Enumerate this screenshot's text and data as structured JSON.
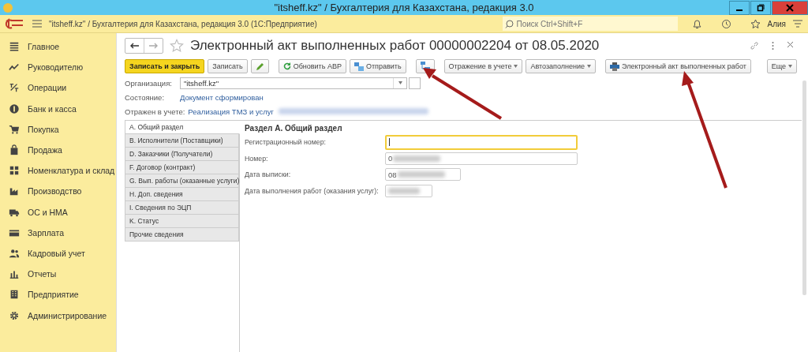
{
  "window": {
    "title": "\"itsheff.kz\" / Бухгалтерия для Казахстана, редакция 3.0"
  },
  "app_bar": {
    "title": "\"itsheff.kz\" / Бухгалтерия для Казахстана, редакция 3.0  (1С:Предприятие)",
    "search": {
      "placeholder": "Поиск Ctrl+Shift+F"
    },
    "user": "Алия"
  },
  "sidebar": {
    "items": [
      {
        "label": "Главное"
      },
      {
        "label": "Руководителю"
      },
      {
        "label": "Операции"
      },
      {
        "label": "Банк и касса"
      },
      {
        "label": "Покупка"
      },
      {
        "label": "Продажа"
      },
      {
        "label": "Номенклатура и склад"
      },
      {
        "label": "Производство"
      },
      {
        "label": "ОС и НМА"
      },
      {
        "label": "Зарплата"
      },
      {
        "label": "Кадровый учет"
      },
      {
        "label": "Отчеты"
      },
      {
        "label": "Предприятие"
      },
      {
        "label": "Администрирование"
      }
    ]
  },
  "document": {
    "title": "Электронный акт выполненных работ 00000002204 от 08.05.2020",
    "toolbar": [
      {
        "kind": "primary",
        "label": "Записать и закрыть"
      },
      {
        "kind": "plain",
        "label": "Записать"
      },
      {
        "kind": "pencil"
      },
      {
        "kind": "refresh",
        "label": "Обновить АВР"
      },
      {
        "kind": "send",
        "label": "Отправить"
      },
      {
        "kind": "structure"
      },
      {
        "kind": "dropdown",
        "label": "Отражение в учете"
      },
      {
        "kind": "dropdown",
        "label": "Автозаполнение"
      },
      {
        "kind": "print",
        "label": "Электронный акт выполненных работ"
      },
      {
        "kind": "more",
        "label": "Еще"
      }
    ],
    "organization": {
      "label": "Организация:",
      "value": "\"itsheff.kz\""
    },
    "state": {
      "label": "Состояние:",
      "value": "Документ сформирован"
    },
    "posted": {
      "label": "Отражен в учете:",
      "value": "Реализация ТМЗ и услуг"
    },
    "tabs": [
      {
        "label": "A. Общий раздел",
        "selected": true
      },
      {
        "label": "B. Исполнители (Поставщики)",
        "selected": false
      },
      {
        "label": "D. Заказчики (Получатели)",
        "selected": false
      },
      {
        "label": "F. Договор (контракт)",
        "selected": false
      },
      {
        "label": "G. Вып. работы (оказанные услуги)",
        "selected": false
      },
      {
        "label": "H. Доп. сведения",
        "selected": false
      },
      {
        "label": "I. Сведения по ЭЦП",
        "selected": false
      },
      {
        "label": "K. Статус",
        "selected": false
      },
      {
        "label": "Прочие сведения",
        "selected": false
      }
    ],
    "section_title": "Раздел А. Общий раздел",
    "fields": [
      {
        "label": "Регистрационный номер:",
        "focused": true
      },
      {
        "label": "Номер:",
        "value": "0",
        "focused": false
      },
      {
        "label": "Дата выписки:",
        "value": "08",
        "focused": false
      },
      {
        "label": "Дата выполнения работ (оказания услуг):",
        "focused": false
      }
    ]
  }
}
